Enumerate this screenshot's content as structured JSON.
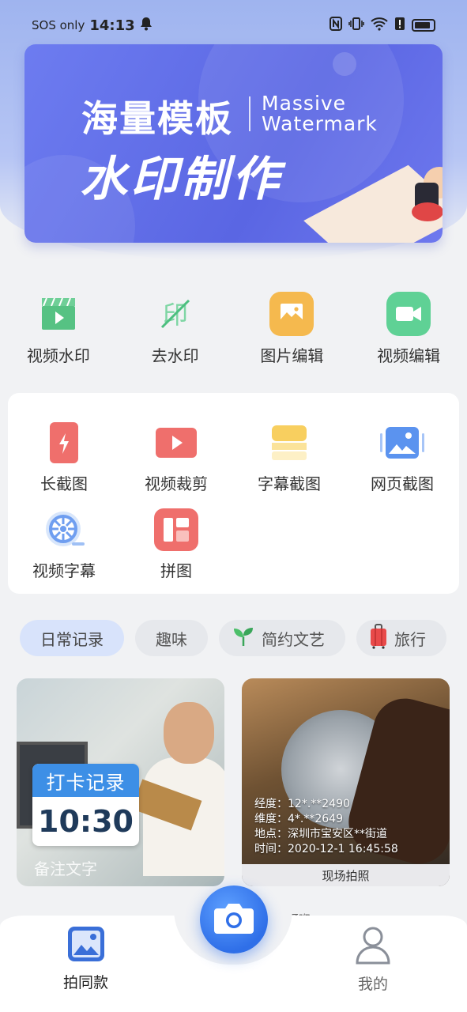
{
  "status_bar": {
    "carrier": "SOS only",
    "time": "14:13"
  },
  "banner": {
    "title_cn": "海量模板",
    "title_en_line1": "Massive",
    "title_en_line2": "Watermark",
    "main_title": "水印制作"
  },
  "tools": [
    {
      "label": "视频水印",
      "icon": "video-watermark-icon"
    },
    {
      "label": "去水印",
      "icon": "remove-watermark-icon"
    },
    {
      "label": "图片编辑",
      "icon": "image-edit-icon"
    },
    {
      "label": "视频编辑",
      "icon": "video-edit-icon"
    }
  ],
  "grid": [
    {
      "label": "长截图",
      "icon": "long-screenshot-icon"
    },
    {
      "label": "视频裁剪",
      "icon": "video-trim-icon"
    },
    {
      "label": "字幕截图",
      "icon": "subtitle-screenshot-icon"
    },
    {
      "label": "网页截图",
      "icon": "webpage-screenshot-icon"
    },
    {
      "label": "视频字幕",
      "icon": "video-subtitle-icon"
    },
    {
      "label": "拼图",
      "icon": "collage-icon"
    }
  ],
  "categories": [
    {
      "label": "日常记录",
      "active": true
    },
    {
      "label": "趣味",
      "active": false
    },
    {
      "label": "简约文艺",
      "active": false,
      "icon": "sprout-icon"
    },
    {
      "label": "旅行",
      "active": false,
      "icon": "suitcase-icon"
    }
  ],
  "templates": [
    {
      "checkin_title": "打卡记录",
      "checkin_time": "10:30",
      "note": "备注文字"
    },
    {
      "lines": [
        "经度：12*.**2490",
        "维度：4*.**2649",
        "地点：深圳市宝安区**街道",
        "时间：2020-12-1  16:45:58"
      ],
      "caption": "现场拍照"
    }
  ],
  "peek_text": "咿呀咿",
  "tabbar": {
    "tab1": "拍同款",
    "tab2": "我的"
  },
  "colors": {
    "accent": "#2f6fe8",
    "banner": "#5a66e3",
    "checkin_header": "#3d8fe6"
  }
}
